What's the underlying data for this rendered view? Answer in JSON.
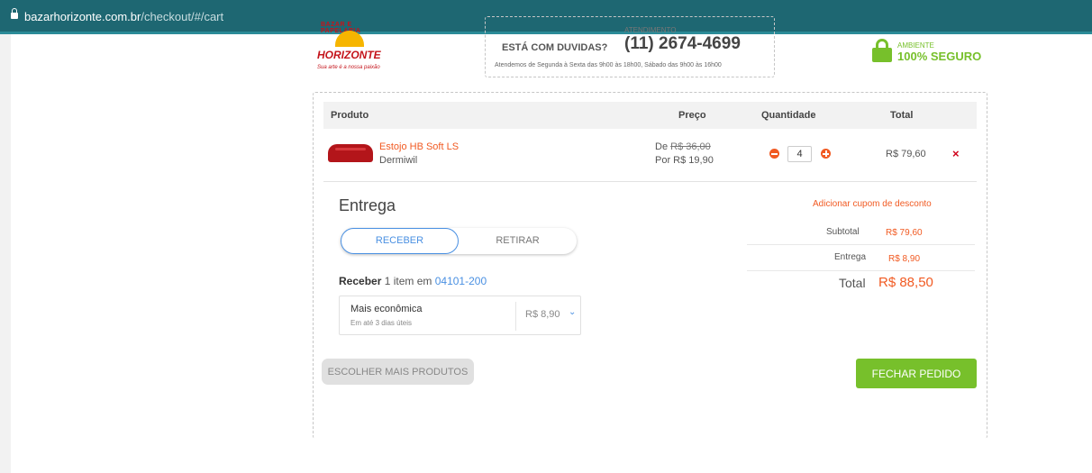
{
  "browser": {
    "domain": "bazarhorizonte.com.br",
    "path": "/checkout/#/cart"
  },
  "brand": {
    "arc_text": "BAZAR E PAPELARIA",
    "name": "HORIZONTE",
    "slogan": "Sua arte é a nossa paixão"
  },
  "support": {
    "question": "ESTÁ COM DUVIDAS?",
    "label": "ATENDIMENTO",
    "phone": "(11) 2674-4699",
    "hours": "Atendemos de Segunda à Sexta das 9h00 às 18h00, Sábado das 9h00 às 16h00"
  },
  "secure": {
    "line1": "AMBIENTE",
    "line2": "100% SEGURO",
    "color": "#77c02b"
  },
  "cart": {
    "headers": {
      "product": "Produto",
      "price": "Preço",
      "quantity": "Quantidade",
      "total": "Total"
    },
    "item": {
      "name": "Estojo HB Soft LS",
      "brand": "Dermiwil",
      "price_from_label": "De",
      "price_from": "R$ 36,00",
      "price_to": "Por R$ 19,90",
      "quantity": "4",
      "total": "R$ 79,60",
      "remove_icon": "×"
    }
  },
  "shipping": {
    "title": "Entrega",
    "tab_receive": "RECEBER",
    "tab_pickup": "RETIRAR",
    "receive_label": "Receber",
    "receive_text": " 1 item em ",
    "cep": "04101-200",
    "option": {
      "name": "Mais econômica",
      "detail": "Em até 3 dias úteis",
      "price": "R$ 8,90",
      "chevron": "⌄"
    }
  },
  "summary": {
    "coupon": "Adicionar cupom de desconto",
    "subtotal_label": "Subtotal",
    "subtotal": "R$ 79,60",
    "shipping_label": "Entrega",
    "shipping": "R$ 8,90",
    "total_label": "Total",
    "total": "R$ 88,50"
  },
  "actions": {
    "more_products": "ESCOLHER MAIS PRODUTOS",
    "close_order": "FECHAR PEDIDO"
  },
  "colors": {
    "accent": "#f15a22",
    "link": "#4a90e2",
    "topbar": "#1e6772"
  }
}
